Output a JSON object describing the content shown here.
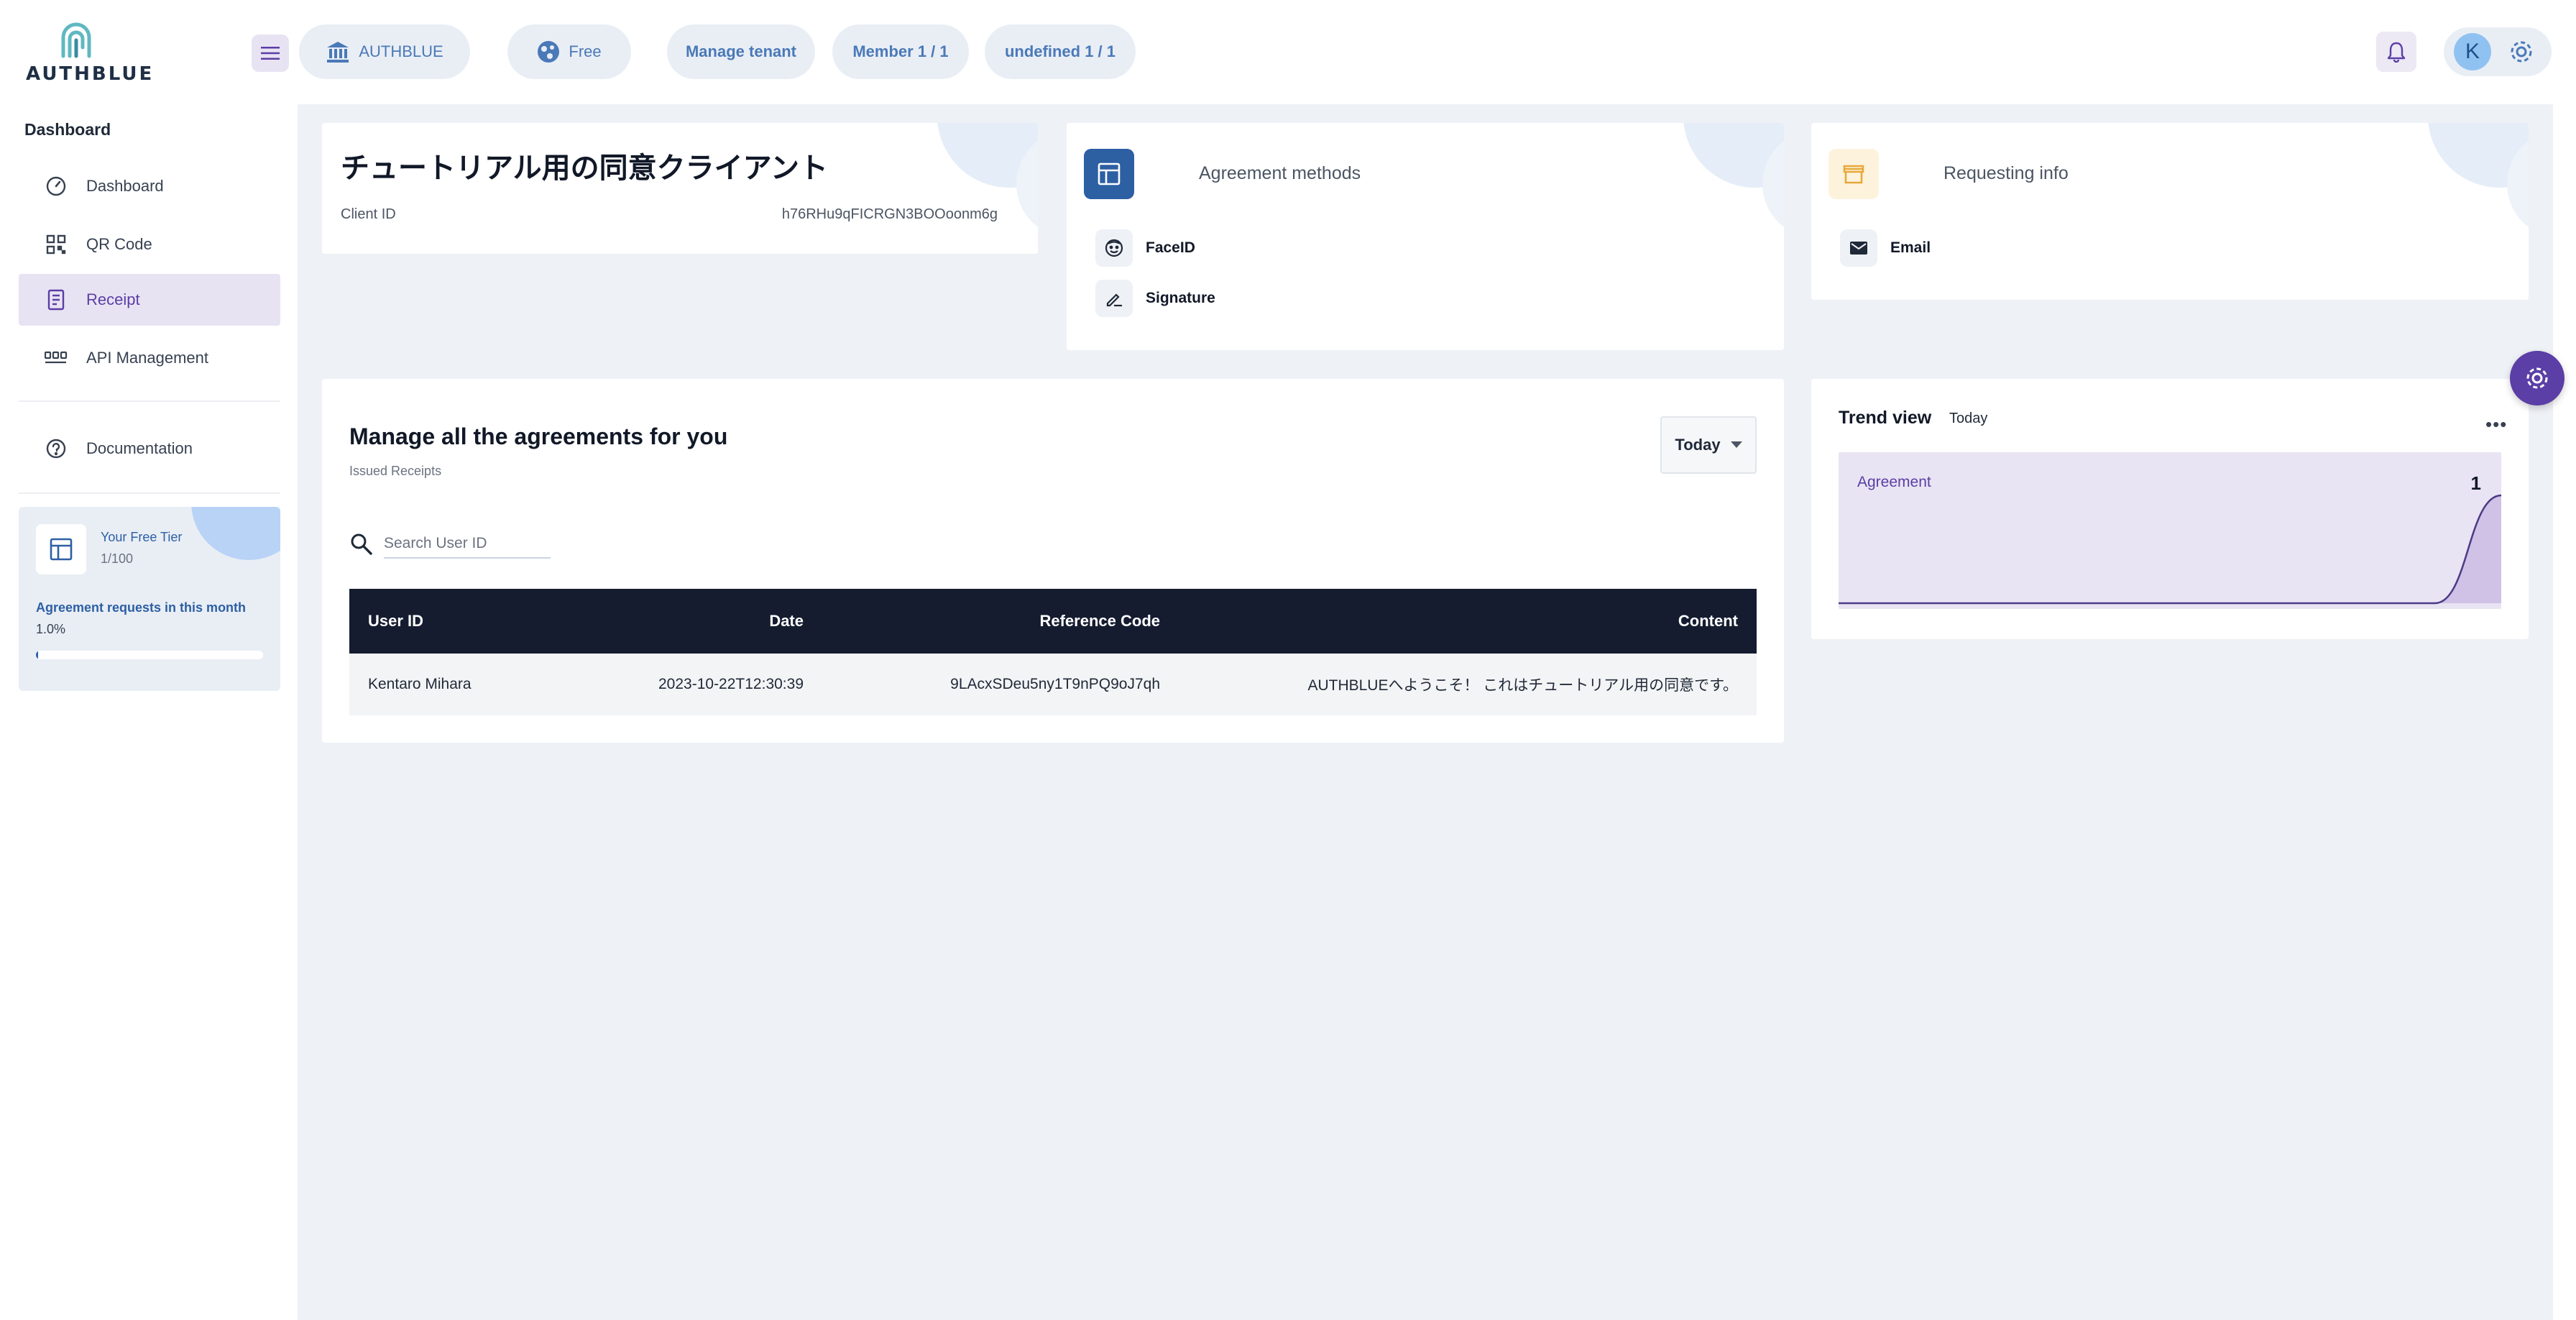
{
  "brand": {
    "name": "AUTHBLUE",
    "accent": "#5b3ea6",
    "primary": "#2d5fa3"
  },
  "header": {
    "pills": [
      {
        "label": "AUTHBLUE",
        "icon": "bank-icon"
      },
      {
        "label": "Free",
        "icon": "planet-icon"
      },
      {
        "label": "Manage tenant"
      },
      {
        "label": "Member 1 / 1"
      },
      {
        "label": "undefined 1 / 1"
      }
    ],
    "avatar_initial": "K"
  },
  "sidebar": {
    "heading": "Dashboard",
    "items": [
      {
        "label": "Dashboard",
        "icon": "speedometer-icon",
        "active": false
      },
      {
        "label": "QR Code",
        "icon": "qr-code-icon",
        "active": false
      },
      {
        "label": "Receipt",
        "icon": "receipt-icon",
        "active": true
      },
      {
        "label": "API Management",
        "icon": "api-icon",
        "active": false
      },
      {
        "label": "Documentation",
        "icon": "help-circle-icon",
        "active": false
      }
    ],
    "tier": {
      "title": "Your Free Tier",
      "count": "1/100",
      "label": "Agreement requests in this month",
      "percent": "1.0%",
      "progress": 0.01
    }
  },
  "client": {
    "title": "チュートリアル用の同意クライアント",
    "id_label": "Client ID",
    "id_value": "h76RHu9qFICRGN3BOOoonm6g"
  },
  "methods": {
    "title": "Agreement methods",
    "items": [
      {
        "label": "FaceID",
        "icon": "face-icon"
      },
      {
        "label": "Signature",
        "icon": "signature-icon"
      }
    ]
  },
  "requesting": {
    "title": "Requesting info",
    "items": [
      {
        "label": "Email",
        "icon": "mail-icon"
      }
    ]
  },
  "agreements": {
    "title": "Manage all the agreements for you",
    "subtitle": "Issued Receipts",
    "range": "Today",
    "search_placeholder": "Search User ID",
    "search_value": "",
    "columns": [
      "User ID",
      "Date",
      "Reference Code",
      "Content"
    ],
    "rows": [
      [
        "Kentaro Mihara",
        "2023-10-22T12:30:39",
        "9LAcxSDeu5ny1T9nPQ9oJ7qh",
        "AUTHBLUEへようこそ！ これはチュートリアル用の同意です。"
      ]
    ]
  },
  "trend": {
    "title": "Trend view",
    "range": "Today",
    "label": "Agreement",
    "value": "1"
  },
  "chart_data": {
    "type": "area",
    "title": "Trend view",
    "series": [
      {
        "name": "Agreement",
        "values": [
          0,
          0,
          0,
          0,
          0,
          0,
          0,
          0,
          0,
          0,
          1
        ]
      }
    ],
    "ylim": [
      0,
      1
    ],
    "grid": false
  }
}
